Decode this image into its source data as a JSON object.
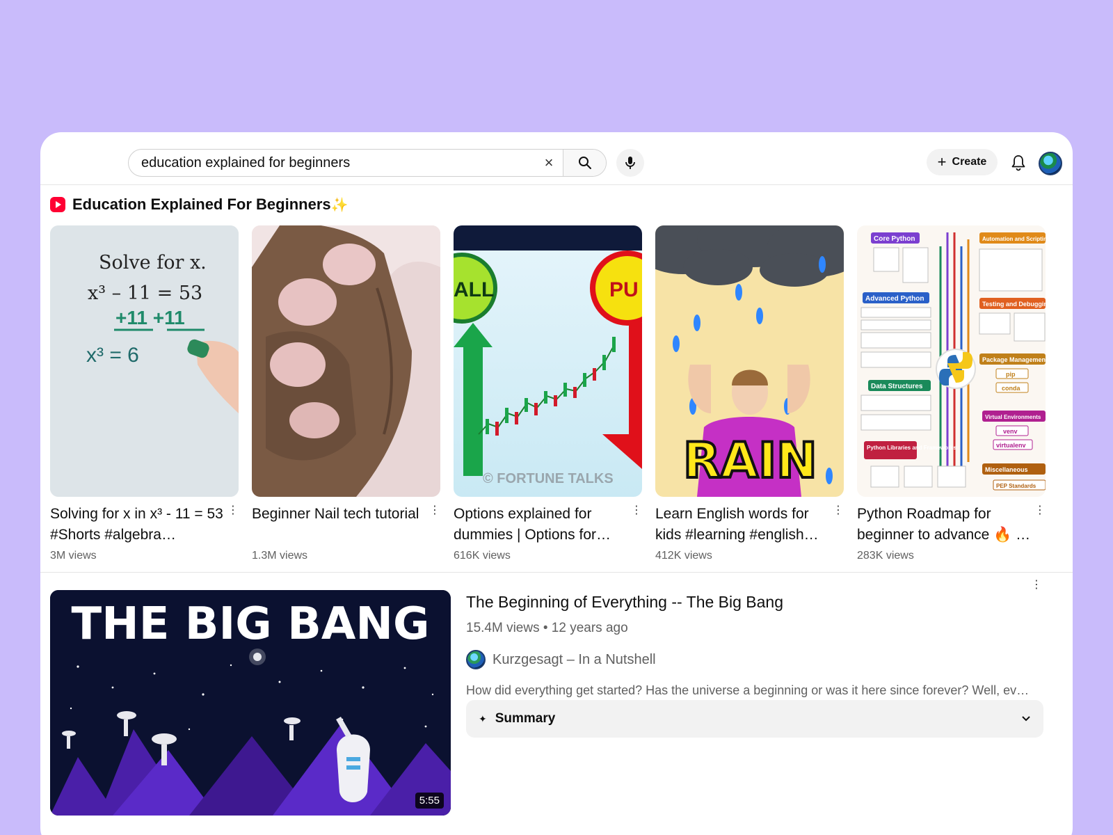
{
  "search": {
    "value": "education explained for beginners",
    "clear_glyph": "×"
  },
  "header": {
    "create_label": "Create",
    "create_plus": "+"
  },
  "shelf": {
    "title": "Education Explained For Beginners",
    "sparkle": "✨"
  },
  "shorts": [
    {
      "title": "Solving for x in x³ - 11 = 53 #Shorts #algebra…",
      "views": "3M views"
    },
    {
      "title": "Beginner Nail tech tutorial",
      "views": "1.3M views"
    },
    {
      "title": "Options explained for dummies | Options for…",
      "views": "616K views"
    },
    {
      "title": "Learn English words for kids #learning #english…",
      "views": "412K views"
    },
    {
      "title": "Python Roadmap for beginner to advance 🔥 …",
      "views": "283K views"
    }
  ],
  "thumb_text": {
    "math_line1": "Solve for x.",
    "math_line2": "x³ – 11 = 53",
    "math_line3": "+11  +11",
    "math_line4": "x³    = 6",
    "options_left": "ALL",
    "options_right": "PU",
    "options_watermark": "© FORTUNE TALKS",
    "rain_word": "RAIN",
    "py_core": "Core Python",
    "py_adv": "Advanced Python",
    "py_ds": "Data Structures",
    "py_libs": "Python Libraries and Frameworks",
    "py_auto": "Automation and Scripting",
    "py_test": "Testing and Debugging",
    "py_pkg": "Package Management",
    "py_pip": "pip",
    "py_conda": "conda",
    "py_venv_head": "Virtual Environments",
    "py_venv": "venv",
    "py_virtualenv": "virtualenv",
    "py_misc": "Miscellaneous",
    "py_pep": "PEP Standards"
  },
  "video": {
    "thumb_title": "THE BIG BANG",
    "duration": "5:55",
    "title": "The Beginning of Everything -- The Big Bang",
    "stats": "15.4M views • 12 years ago",
    "channel": "Kurzgesagt – In a Nutshell",
    "description": "How did everything get started? Has the universe a beginning or was it here since forever? Well, ev…",
    "summary_label": "Summary",
    "summary_spark": "✦",
    "chevron": "⌄"
  },
  "colors": {
    "background": "#c9bbfb",
    "brand_red": "#ff0033",
    "secondary_text": "#606060"
  },
  "icons": [
    "search-icon",
    "close-icon",
    "mic-icon",
    "bell-icon",
    "plus-icon",
    "more-vert-icon",
    "chevron-down-icon",
    "sparkle-icon"
  ]
}
